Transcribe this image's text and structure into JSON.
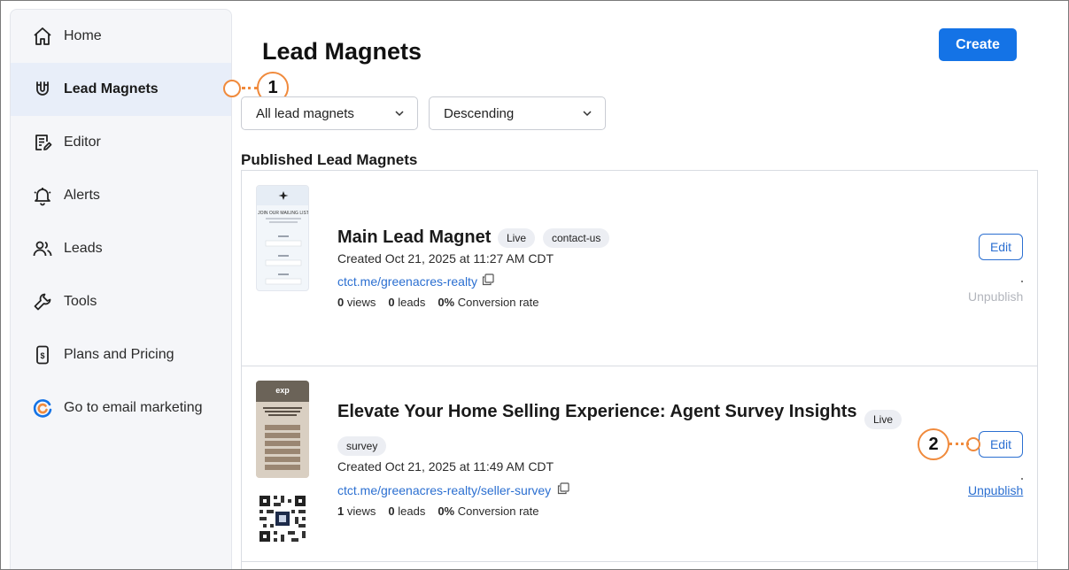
{
  "sidebar": {
    "items": [
      {
        "label": "Home",
        "icon": "home-icon"
      },
      {
        "label": "Lead Magnets",
        "icon": "magnet-icon",
        "active": true
      },
      {
        "label": "Editor",
        "icon": "editor-icon"
      },
      {
        "label": "Alerts",
        "icon": "bell-icon"
      },
      {
        "label": "Leads",
        "icon": "users-icon"
      },
      {
        "label": "Tools",
        "icon": "wrench-icon"
      },
      {
        "label": "Plans and Pricing",
        "icon": "pricing-icon"
      },
      {
        "label": "Go to email marketing",
        "icon": "constant-contact-logo-icon"
      }
    ]
  },
  "header": {
    "title": "Lead Magnets",
    "create_label": "Create"
  },
  "filters": {
    "type_selected": "All lead magnets",
    "sort_selected": "Descending"
  },
  "section": {
    "title": "Published Lead Magnets"
  },
  "cards": [
    {
      "title": "Main Lead Magnet",
      "status": "Live",
      "tag": "contact-us",
      "created": "Created Oct 21, 2025 at 11:27 AM CDT",
      "url": "ctct.me/greenacres-realty",
      "views": "0",
      "views_label": "views",
      "leads": "0",
      "leads_label": "leads",
      "conversion": "0%",
      "conversion_label": "Conversion rate",
      "edit_label": "Edit",
      "unpublish_label": "Unpublish",
      "thumb": {
        "heading": "JOIN OUR MAILING LIST",
        "sub": "Be the first to know about new arrivals, sales and events",
        "fields": [
          "Name",
          "Email",
          "Phone"
        ]
      }
    },
    {
      "title": "Elevate Your Home Selling Experience: Agent Survey Insights",
      "status": "Live",
      "tag": "survey",
      "created": "Created Oct 21, 2025 at 11:49 AM CDT",
      "url": "ctct.me/greenacres-realty/seller-survey",
      "views": "1",
      "views_label": "views",
      "leads": "0",
      "leads_label": "leads",
      "conversion": "0%",
      "conversion_label": "Conversion rate",
      "edit_label": "Edit",
      "unpublish_label": "Unpublish",
      "thumb": {
        "brand": "exp",
        "question": "What is your main goal in selling your home?"
      }
    }
  ],
  "callouts": [
    "1",
    "2"
  ],
  "colors": {
    "accent": "#1473e6",
    "link": "#2b6fd1",
    "callout": "#f08a3c",
    "sidebar_bg": "#f5f6f9",
    "active_bg": "#e8eef9"
  }
}
